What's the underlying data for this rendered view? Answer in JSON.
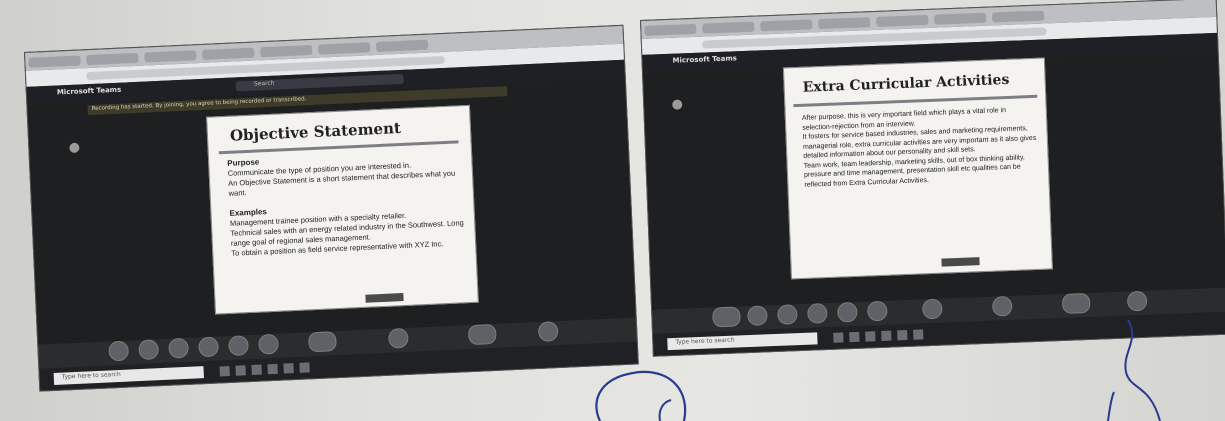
{
  "left_screen": {
    "app_title": "Microsoft Teams",
    "search_label": "Search",
    "notice": "Recording has started. By joining, you agree to being recorded or transcribed.",
    "slide": {
      "title": "Objective Statement",
      "purpose_heading": "Purpose",
      "purpose_items": [
        "Communicate the type of position you are interested in.",
        "An Objective Statement is a short statement that describes what you want."
      ],
      "examples_heading": "Examples",
      "examples_items": [
        "Management trainee position with a specialty retailer.",
        "Technical sales with an energy related industry in the Southwest. Long range goal of regional sales management.",
        "To obtain a position as field service representative with XYZ Inc."
      ]
    },
    "taskbar_search": "Type here to search"
  },
  "right_screen": {
    "app_title": "Microsoft Teams",
    "slide": {
      "title": "Extra Curricular Activities",
      "paragraphs": [
        "After purpose, this is very important field which plays a vital role in selection-rejection from an interview.",
        "It fosters for service based industries, sales and marketing requirements, managerial role, extra curricular activities are very important as it also gives detailed information about our personality and skill sets.",
        "Team work, team leadership, marketing skills, out of box thinking ability, pressure and time management, presentation skill etc qualities can be reflected from Extra Curricular Activities."
      ]
    },
    "taskbar_search": "Type here to search"
  },
  "colors": {
    "teams_dark": "#1e1f21",
    "slide_bg": "#f4f3ef",
    "ink_blue": "#2a3a8f"
  }
}
